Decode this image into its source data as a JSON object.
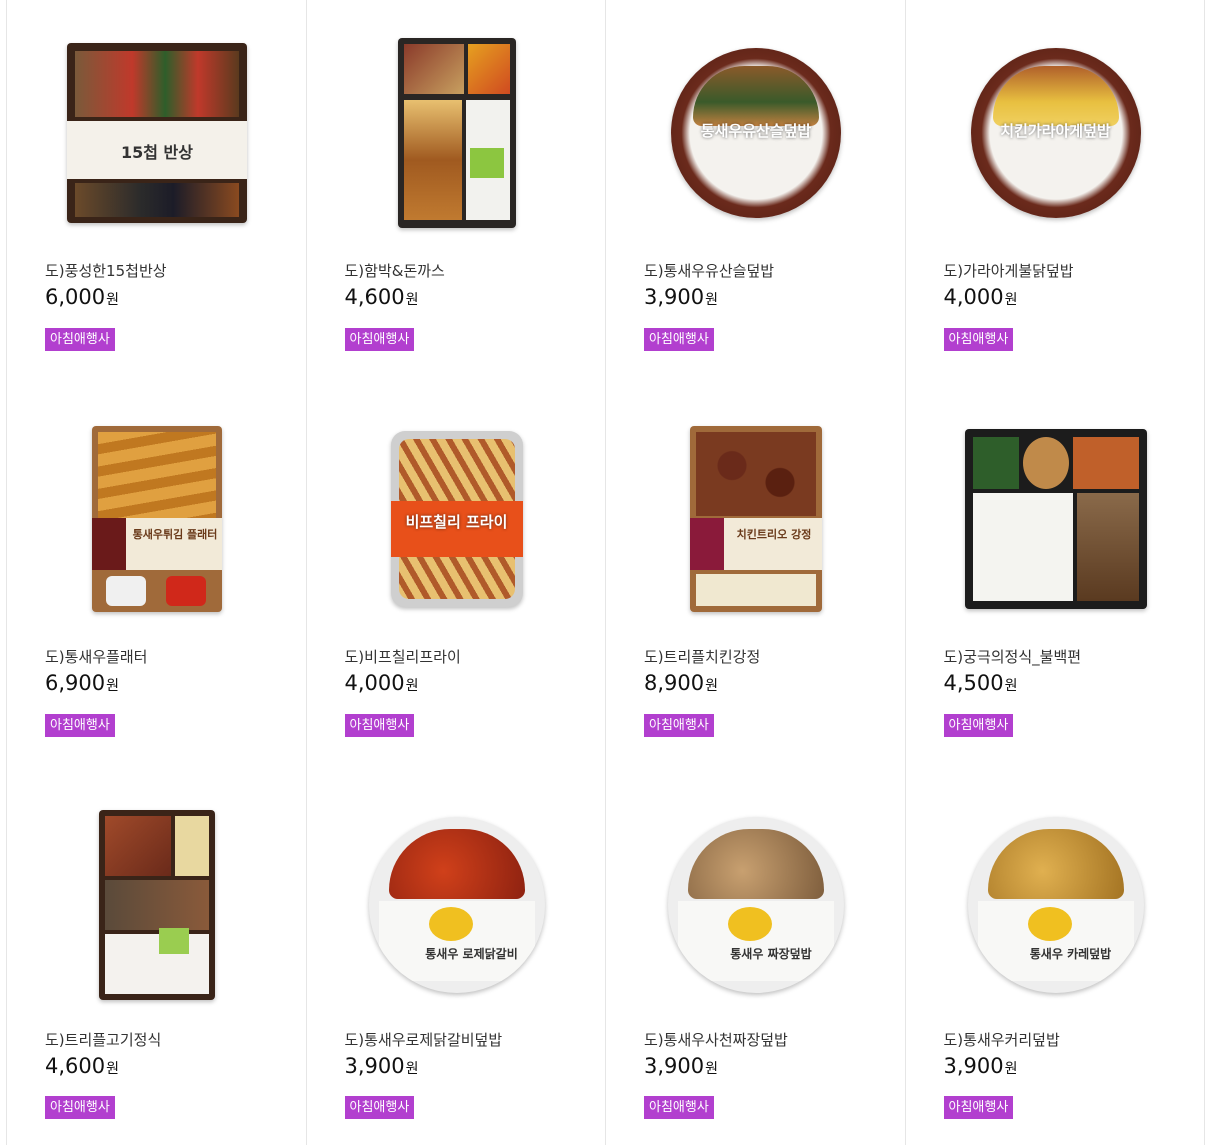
{
  "badge_color": "#b23fcf",
  "currency_unit": "원",
  "products": [
    {
      "name": "도)풍성한15첩반상",
      "price": "6,000",
      "badge": "아침애행사",
      "icon": "lunchbox-15-dishes-image",
      "label": "15첩 반상"
    },
    {
      "name": "도)함박&돈까스",
      "price": "4,600",
      "badge": "아침애행사",
      "icon": "hamburg-pork-cutlet-box-image",
      "label": ""
    },
    {
      "name": "도)통새우유산슬덮밥",
      "price": "3,900",
      "badge": "아침애행사",
      "icon": "shrimp-rice-bowl-image",
      "label": "통새우유산슬덮밥"
    },
    {
      "name": "도)가라아게불닭덮밥",
      "price": "4,000",
      "badge": "아침애행사",
      "icon": "chicken-karaage-rice-bowl-image",
      "label": "치킨가라아게덮밥"
    },
    {
      "name": "도)통새우플래터",
      "price": "6,900",
      "badge": "아침애행사",
      "icon": "fried-shrimp-platter-image",
      "label": "통새우튀김 플래터"
    },
    {
      "name": "도)비프칠리프라이",
      "price": "4,000",
      "badge": "아침애행사",
      "icon": "beef-chili-fries-image",
      "label": "비프칠리 프라이"
    },
    {
      "name": "도)트리플치킨강정",
      "price": "8,900",
      "badge": "아침애행사",
      "icon": "triple-chicken-gangjeong-image",
      "label": "치킨트리오 강정"
    },
    {
      "name": "도)궁극의정식_불백편",
      "price": "4,500",
      "badge": "아침애행사",
      "icon": "bulbaek-set-meal-image",
      "label": ""
    },
    {
      "name": "도)트리플고기정식",
      "price": "4,600",
      "badge": "아침애행사",
      "icon": "triple-meat-set-meal-image",
      "label": ""
    },
    {
      "name": "도)통새우로제닭갈비덮밥",
      "price": "3,900",
      "badge": "아침애행사",
      "icon": "rose-dakgalbi-rice-bowl-image",
      "label": "통새우 로제닭갈비"
    },
    {
      "name": "도)통새우사천짜장덮밥",
      "price": "3,900",
      "badge": "아침애행사",
      "icon": "sichuan-jjajang-rice-bowl-image",
      "label": "통새우 짜장덮밥"
    },
    {
      "name": "도)통새우커리덮밥",
      "price": "3,900",
      "badge": "아침애행사",
      "icon": "shrimp-curry-rice-bowl-image",
      "label": "통새우 카레덮밥"
    }
  ]
}
